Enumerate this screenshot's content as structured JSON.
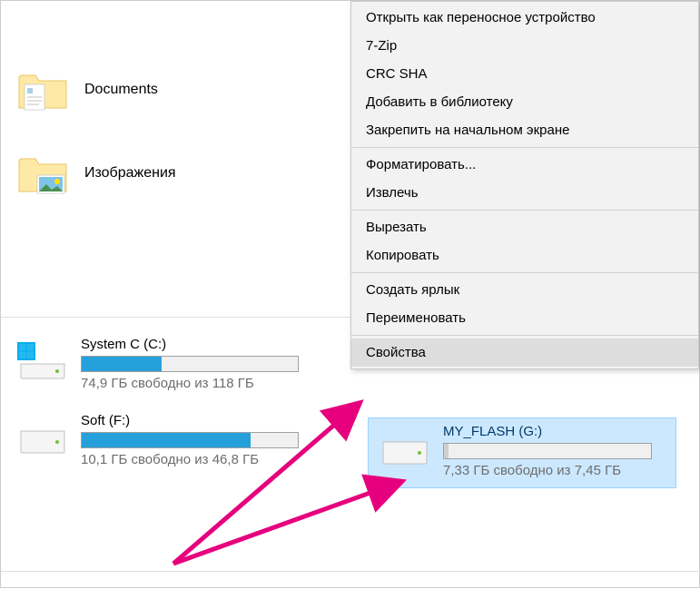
{
  "folders": {
    "documents": {
      "label": "Documents"
    },
    "images": {
      "label": "Изображения"
    }
  },
  "drives": {
    "system_c": {
      "label": "System C (C:)",
      "status": "74,9 ГБ свободно из 118 ГБ",
      "fill_percent": 37
    },
    "soft_f": {
      "label": "Soft (F:)",
      "status": "10,1 ГБ свободно из 46,8 ГБ",
      "fill_percent": 78
    },
    "flash_g": {
      "label": "MY_FLASH (G:)",
      "status": "7,33 ГБ свободно из 7,45 ГБ",
      "fill_percent": 2
    }
  },
  "context_menu": {
    "open_portable": "Открыть как переносное устройство",
    "seven_zip": "7-Zip",
    "crc_sha": "CRC SHA",
    "add_library": "Добавить в библиотеку",
    "pin_start": "Закрепить на начальном экране",
    "format": "Форматировать...",
    "eject": "Извлечь",
    "cut": "Вырезать",
    "copy": "Копировать",
    "create_shortcut": "Создать ярлык",
    "rename": "Переименовать",
    "properties": "Свойства"
  },
  "colors": {
    "progress_fill": "#26a0da",
    "selection_bg": "#cce8ff",
    "selection_border": "#99d1ff",
    "arrow": "#e6007e",
    "menu_bg": "#f2f2f2",
    "status_text": "#6d6d6d"
  }
}
